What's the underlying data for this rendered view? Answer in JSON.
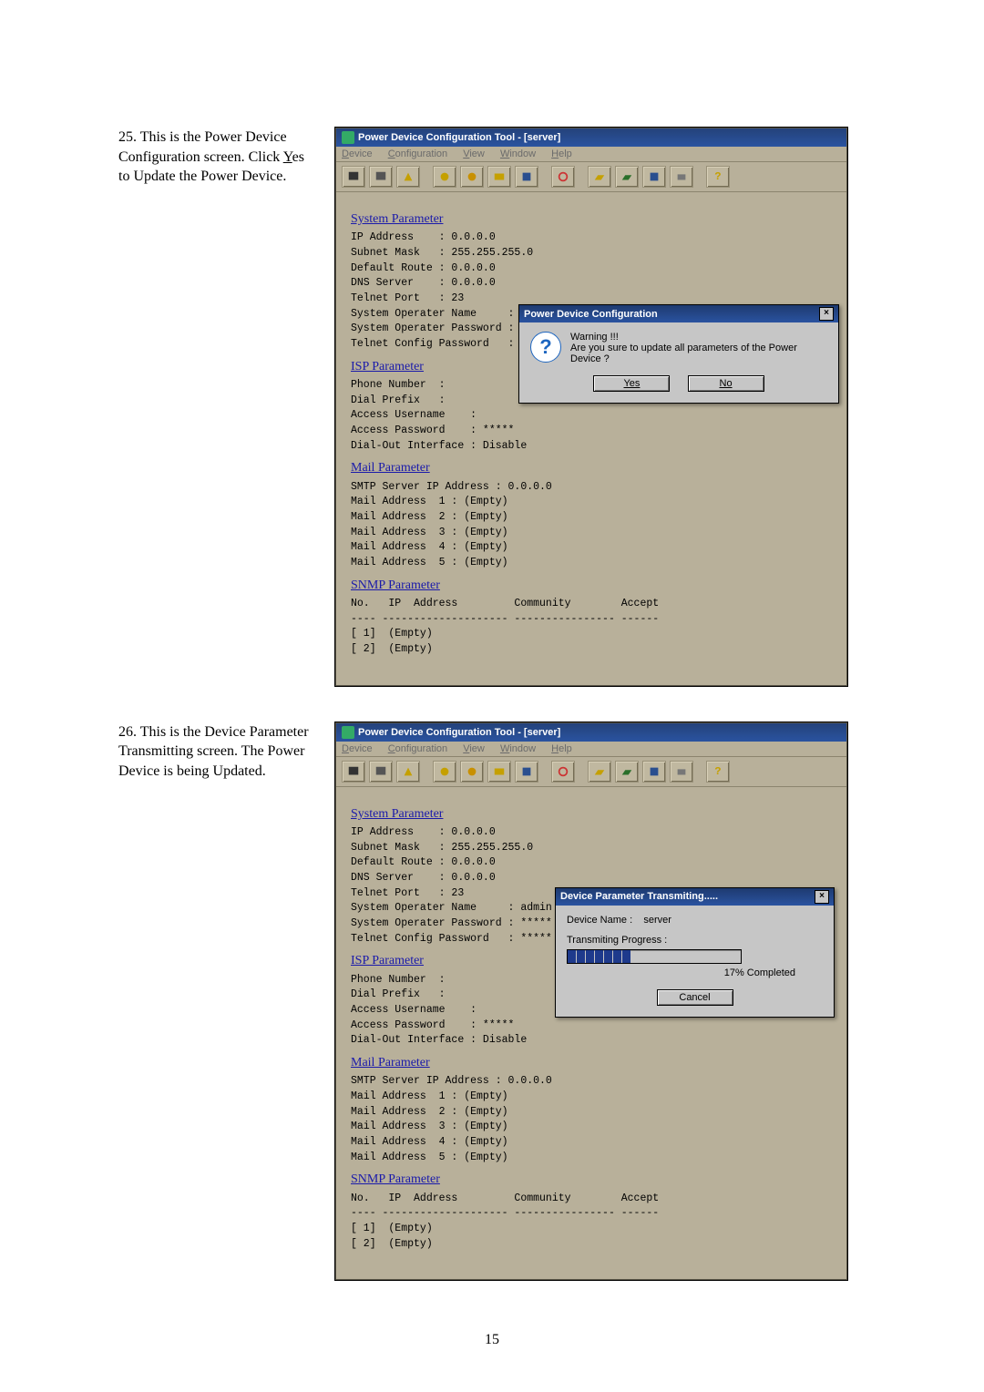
{
  "step25": {
    "num": "25.",
    "text_a": "This is the Power Device Configuration screen.  Click ",
    "yes_char": "Y",
    "yes_rest": "es",
    "text_b": " to Update the Power Device."
  },
  "step26": {
    "num": "26.",
    "text": "This is the Device Parameter Transmitting screen.  The Power Device is being Updated."
  },
  "window": {
    "title": "Power Device Configuration Tool - [server]",
    "menu": {
      "device": "Device",
      "config": "Configuration",
      "view": "View",
      "window": "Window",
      "help": "Help"
    }
  },
  "sections": {
    "system": "System Parameter",
    "isp": "ISP Parameter",
    "mail": "Mail Parameter",
    "snmp": "SNMP Parameter"
  },
  "system_lines": [
    "IP Address    : 0.0.0.0",
    "Subnet Mask   : 255.255.255.0",
    "Default Route : 0.0.0.0",
    "DNS Server    : 0.0.0.0",
    "Telnet Port   : 23",
    "System Operater Name     : admin",
    "System Operater Password : *****",
    "Telnet Config Password   : *****"
  ],
  "isp_lines": [
    "Phone Number  :",
    "Dial Prefix   :",
    "Access Username    :",
    "Access Password    : *****",
    "Dial-Out Interface : Disable"
  ],
  "mail_lines": [
    "SMTP Server IP Address : 0.0.0.0",
    "Mail Address  1 : (Empty)",
    "Mail Address  2 : (Empty)",
    "Mail Address  3 : (Empty)",
    "Mail Address  4 : (Empty)",
    "Mail Address  5 : (Empty)"
  ],
  "snmp_lines": [
    "No.   IP  Address         Community        Accept",
    "---- -------------------- ---------------- ------",
    "[ 1]  (Empty)",
    "[ 2]  (Empty)"
  ],
  "dialog1": {
    "title": "Power Device Configuration",
    "warning": "Warning !!!",
    "msg": "Are you sure to update all parameters of the Power Device ?",
    "yes": "Yes",
    "no": "No"
  },
  "dialog2": {
    "title": "Device Parameter Transmiting.....",
    "dev_name_l": "Device Name :",
    "dev_name_v": "server",
    "prog_l": "Transmiting Progress :",
    "pct": "17% Completed",
    "cancel": "Cancel"
  },
  "page_num": "15"
}
